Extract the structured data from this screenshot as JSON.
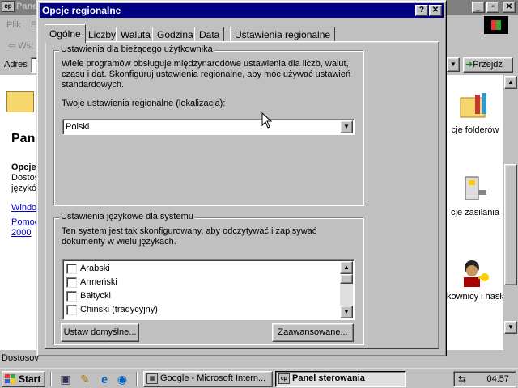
{
  "background_window": {
    "title": "Panel sterowania",
    "title_visible": "Pane",
    "menu": [
      "Plik",
      "E"
    ],
    "back_label": "Wst",
    "address_label": "Adres",
    "go_label": "Przejdź",
    "left_pane": {
      "title": "Pan",
      "line1": "Opcje",
      "line2": "Dostos",
      "line3": "językó",
      "link1": "Windo",
      "link2": "Pomoc",
      "link3": "2000"
    },
    "right_items": [
      {
        "label": "cje folderów",
        "icon": "folder-options-icon"
      },
      {
        "label": "cje zasilania",
        "icon": "power-options-icon"
      },
      {
        "label": "kownicy i hasła",
        "icon": "users-passwords-icon"
      }
    ],
    "status_text": "Dostosov"
  },
  "dialog": {
    "title": "Opcje regionalne",
    "help_label": "?",
    "close_label": "✕",
    "tabs": [
      {
        "label": "Ogólne",
        "active": true
      },
      {
        "label": "Liczby",
        "active": false
      },
      {
        "label": "Waluta",
        "active": false
      },
      {
        "label": "Godzina",
        "active": false
      },
      {
        "label": "Data",
        "active": false
      },
      {
        "label": "Ustawienia regionalne",
        "active": false
      }
    ],
    "user_group": {
      "label": "Ustawienia dla bieżącego użytkownika",
      "description": "Wiele programów obsługuje międzynarodowe ustawienia dla liczb, walut, czasu i dat. Skonfiguruj ustawienia regionalne, aby móc używać ustawień standardowych.",
      "locale_label": "Twoje ustawienia regionalne (lokalizacja):",
      "locale_value": "Polski"
    },
    "system_group": {
      "label": "Ustawienia językowe dla systemu",
      "description": "Ten system jest tak skonfigurowany, aby odczytywać i zapisywać dokumenty w wielu językach.",
      "languages": [
        {
          "label": "Arabski",
          "checked": false
        },
        {
          "label": "Armeński",
          "checked": false
        },
        {
          "label": "Bałtycki",
          "checked": false
        },
        {
          "label": "Chiński (tradycyjny)",
          "checked": false
        }
      ],
      "set_default_button": "Ustaw domyślne...",
      "advanced_button": "Zaawansowane..."
    }
  },
  "taskbar": {
    "start_label": "Start",
    "tasks": [
      {
        "label": "Google - Microsoft Intern...",
        "active": false
      },
      {
        "label": "Panel sterowania",
        "active": true
      }
    ],
    "clock": "04:57"
  },
  "colors": {
    "titlebar_active": "#000080",
    "titlebar_inactive": "#808080",
    "face": "#c0c0c0",
    "link": "#0000cc"
  }
}
